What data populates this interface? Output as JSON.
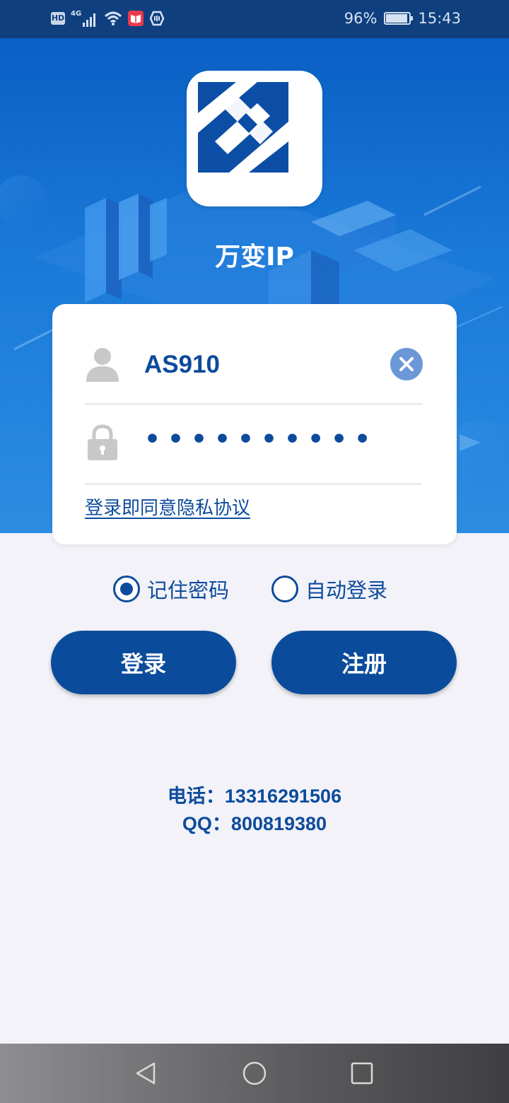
{
  "status_bar": {
    "left_icons": [
      "hd-icon",
      "signal-4g-icon",
      "wifi-icon",
      "book-app-icon",
      "nfc-icon"
    ],
    "network_label": "4G",
    "hd_label": "HD",
    "battery_percent": "96%",
    "battery_level": 0.96,
    "time": "15:43"
  },
  "app": {
    "name": "万变IP",
    "brand_color": "#0b4b9c"
  },
  "login_form": {
    "username_value": "AS910",
    "password_masked": "••••••••••",
    "privacy_link": "登录即同意隐私协议"
  },
  "options": {
    "remember_password": {
      "label": "记住密码",
      "checked": true
    },
    "auto_login": {
      "label": "自动登录",
      "checked": false
    }
  },
  "buttons": {
    "login": "登录",
    "register": "注册"
  },
  "contact": {
    "phone": "电话：13316291506",
    "qq": "QQ：800819380"
  },
  "nav_bar": {
    "buttons": [
      "back-icon",
      "home-icon",
      "recent-apps-icon"
    ]
  }
}
